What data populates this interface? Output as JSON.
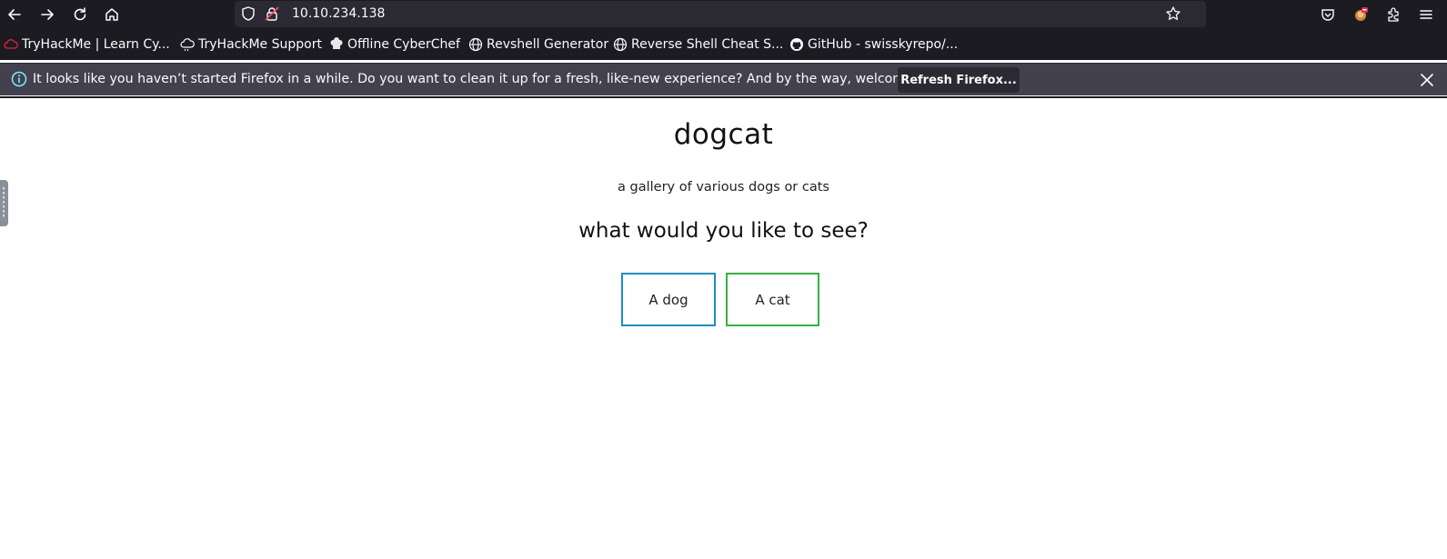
{
  "toolbar": {
    "url": "10.10.234.138"
  },
  "bookmarks": [
    {
      "label": "TryHackMe | Learn Cy...",
      "icon": "tryhackme-cloud-icon"
    },
    {
      "label": "TryHackMe Support",
      "icon": "cloud-icon"
    },
    {
      "label": "Offline CyberChef",
      "icon": "chef-hat-icon"
    },
    {
      "label": "Revshell Generator",
      "icon": "globe-icon"
    },
    {
      "label": "Reverse Shell Cheat S...",
      "icon": "globe-icon"
    },
    {
      "label": "GitHub - swisskyrepo/...",
      "icon": "github-icon"
    }
  ],
  "notification": {
    "text": "It looks like you haven’t started Firefox in a while. Do you want to clean it up for a fresh, like-new experience? And by the way, welcome back!",
    "button_label": "Refresh Firefox..."
  },
  "page": {
    "title": "dogcat",
    "subtitle": "a gallery of various dogs or cats",
    "question": "what would you like to see?",
    "dog_button": "A dog",
    "cat_button": "A cat"
  },
  "colors": {
    "toolbar_bg": "#1c1b22",
    "notification_bg": "#42414d",
    "dog_border": "#1a8fc4",
    "cat_border": "#36b041"
  }
}
